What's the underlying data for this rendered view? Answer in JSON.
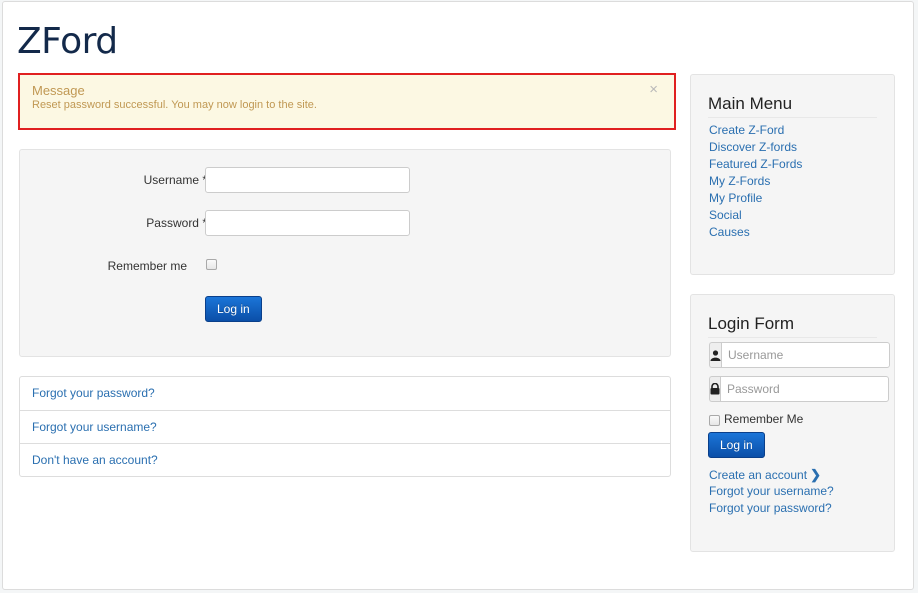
{
  "site": {
    "title": "ZFord"
  },
  "alert": {
    "heading": "Message",
    "text": "Reset password successful. You may now login to the site.",
    "close": "×"
  },
  "login_form": {
    "username_label": "Username *",
    "password_label": "Password *",
    "remember_label": "Remember me",
    "username_value": "",
    "password_value": "",
    "remember_checked": false,
    "submit_label": "Log in"
  },
  "help_links": [
    {
      "label": "Forgot your password?"
    },
    {
      "label": "Forgot your username?"
    },
    {
      "label": "Don't have an account?"
    }
  ],
  "main_menu": {
    "title": "Main Menu",
    "items": [
      {
        "label": "Create Z-Ford"
      },
      {
        "label": "Discover Z-fords"
      },
      {
        "label": "Featured Z-Fords"
      },
      {
        "label": "My Z-Fords"
      },
      {
        "label": "My Profile"
      },
      {
        "label": "Social"
      },
      {
        "label": "Causes"
      }
    ]
  },
  "side_login": {
    "title": "Login Form",
    "username_placeholder": "Username",
    "password_placeholder": "Password",
    "remember_label": "Remember Me",
    "submit_label": "Log in",
    "create_account": "Create an account",
    "forgot_username": "Forgot your username?",
    "forgot_password": "Forgot your password?"
  },
  "colors": {
    "link": "#2a6fb0",
    "alert_bg": "#fcf8e3",
    "alert_text": "#c09853",
    "annotation_red": "#e02020",
    "primary_button": "#0b5fc6"
  },
  "icons": [
    "close-icon",
    "up-arrow-annotation",
    "user-icon",
    "lock-icon",
    "chevron-right-icon"
  ]
}
